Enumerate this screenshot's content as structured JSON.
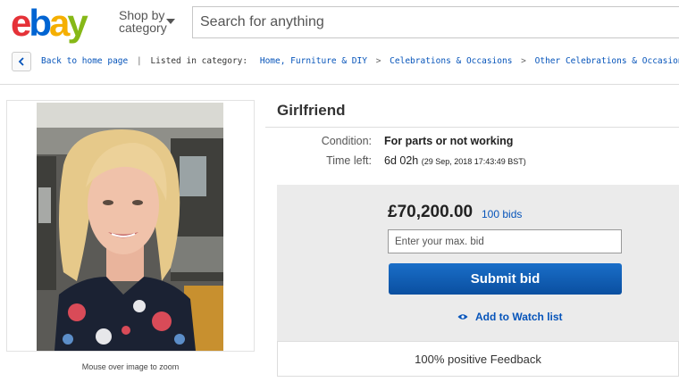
{
  "header": {
    "logo_letters": [
      {
        "ch": "e",
        "color": "#e53238"
      },
      {
        "ch": "b",
        "color": "#0064d2"
      },
      {
        "ch": "a",
        "color": "#f5af02"
      },
      {
        "ch": "y",
        "color": "#86b817"
      }
    ],
    "shop_by_line1": "Shop by",
    "shop_by_line2": "category",
    "search_placeholder": "Search for anything"
  },
  "breadcrumb": {
    "back_label": "Back to home page",
    "listed_label": "Listed in category:",
    "categories": [
      "Home, Furniture & DIY",
      "Celebrations & Occasions",
      "Other Celebrations & Occasions"
    ],
    "separator": ">"
  },
  "image": {
    "zoom_note": "Mouse over image to zoom"
  },
  "listing": {
    "title": "Girlfriend",
    "condition_label": "Condition:",
    "condition_value": "For parts or not working",
    "time_label": "Time left:",
    "time_value": "6d 02h",
    "time_detail": "(29 Sep, 2018   17:43:49 BST)"
  },
  "bid": {
    "price": "£70,200.00",
    "bids": "100 bids",
    "max_bid_placeholder": "Enter your max. bid",
    "submit_label": "Submit bid",
    "watch_label": "Add to Watch list"
  },
  "feedback": {
    "text": "100% positive Feedback"
  },
  "colors": {
    "link": "#0654ba",
    "button": "#0a5fb4"
  }
}
